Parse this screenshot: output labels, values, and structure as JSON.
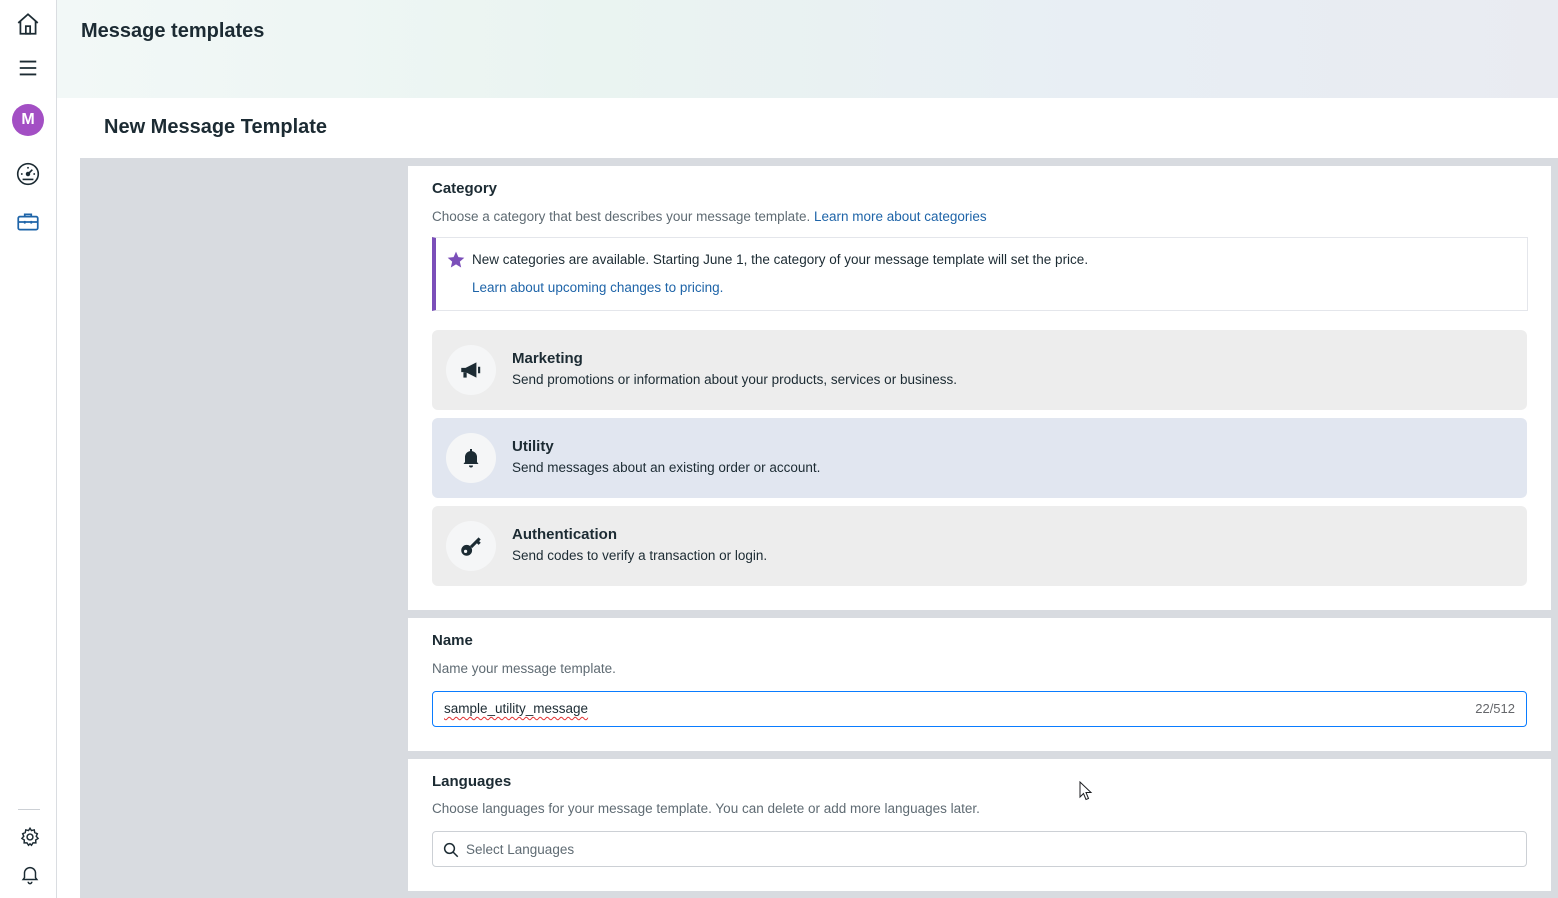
{
  "header": {
    "title": "Message templates"
  },
  "rail": {
    "avatar_letter": "M",
    "items": [
      "home-icon",
      "menu-icon",
      "avatar",
      "speedometer-icon",
      "briefcase-icon",
      "settings-icon",
      "bell-icon"
    ]
  },
  "page": {
    "title": "New Message Template"
  },
  "category": {
    "title": "Category",
    "description": "Choose a category that best describes your message template.",
    "learn_more_link": "Learn more about categories",
    "notice": {
      "text": "New categories are available. Starting June 1, the category of your message template will set the price.",
      "link": "Learn about upcoming changes to pricing."
    },
    "options": [
      {
        "name": "Marketing",
        "description": "Send promotions or information about your products, services or business.",
        "icon": "megaphone-icon",
        "selected": false
      },
      {
        "name": "Utility",
        "description": "Send messages about an existing order or account.",
        "icon": "bell-icon",
        "selected": true
      },
      {
        "name": "Authentication",
        "description": "Send codes to verify a transaction or login.",
        "icon": "key-icon",
        "selected": false
      }
    ]
  },
  "name_section": {
    "title": "Name",
    "description": "Name your message template.",
    "value": "sample_utility_message",
    "counter": "22/512"
  },
  "languages_section": {
    "title": "Languages",
    "description": "Choose languages for your message template. You can delete or add more languages later.",
    "placeholder": "Select Languages"
  },
  "colors": {
    "accent": "#0a7cff",
    "notice_border": "#7b4fb9",
    "link": "#1e64a8",
    "avatar": "#a34fc4",
    "selected_option": "#e1e6f0"
  }
}
